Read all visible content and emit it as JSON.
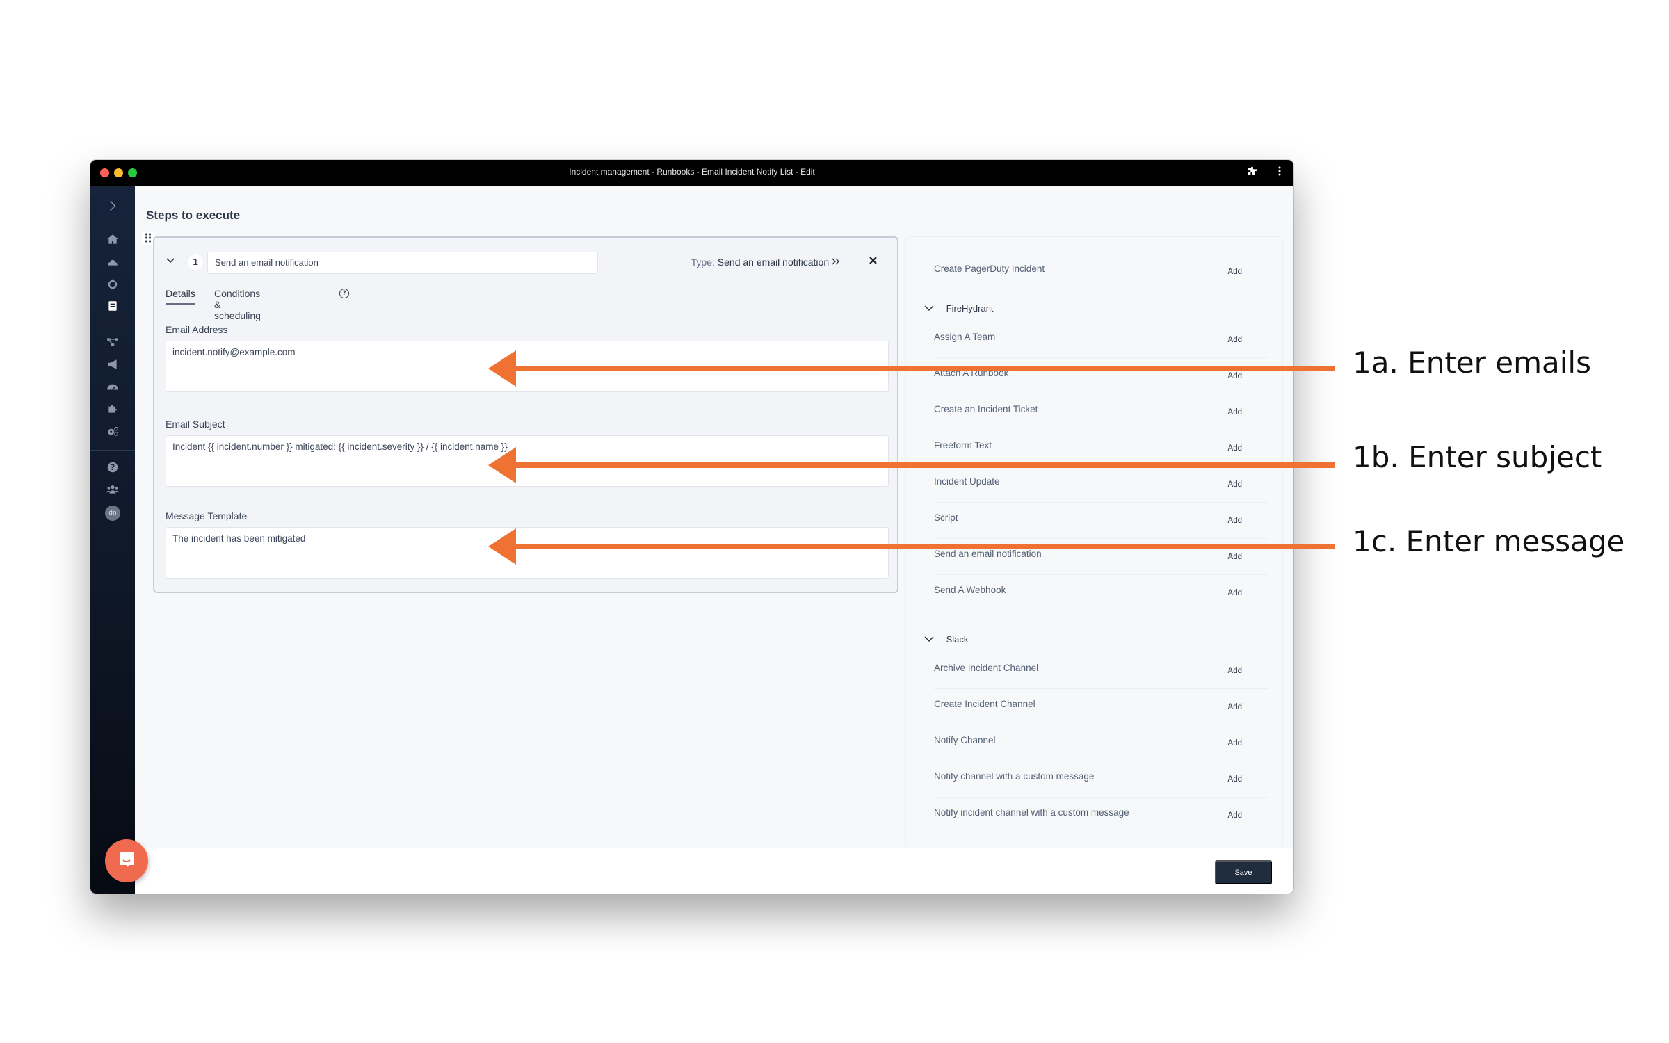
{
  "window": {
    "title": "Incident management - Runbooks - Email Incident Notify List - Edit",
    "controls": [
      "extensions-icon",
      "more-icon"
    ]
  },
  "sidebar": {
    "expand_icon": "chevron-right-icon",
    "items": [
      {
        "icon": "home-icon",
        "active": false
      },
      {
        "icon": "cloud-fire-icon",
        "active": false
      },
      {
        "icon": "fire-icon",
        "active": false
      },
      {
        "icon": "runbook-icon",
        "active": true
      },
      {
        "icon": "services-tree-icon",
        "active": false
      },
      {
        "icon": "megaphone-icon",
        "active": false
      },
      {
        "icon": "dashboard-gauge-icon",
        "active": false
      },
      {
        "icon": "integrations-puzzle-icon",
        "active": false
      },
      {
        "icon": "settings-gears-icon",
        "active": false
      },
      {
        "icon": "help-icon",
        "active": false
      },
      {
        "icon": "team-icon",
        "active": false
      }
    ],
    "avatar_initials": "dn"
  },
  "main": {
    "title": "Steps to execute",
    "step": {
      "number": "1",
      "name": "Send an email notification",
      "type_label": "Type:",
      "type_value": "Send an email notification",
      "tabs": [
        {
          "label": "Details",
          "active": true
        },
        {
          "label": "Conditions & scheduling",
          "active": false
        }
      ],
      "fields": [
        {
          "label": "Email Address",
          "value": "incident.notify@example.com"
        },
        {
          "label": "Email Subject",
          "value": "Incident {{ incident.number }} mitigated: {{ incident.severity }} / {{ incident.name }}"
        },
        {
          "label": "Message Template",
          "value": "The incident has been mitigated"
        }
      ]
    }
  },
  "right_panel": {
    "add_label": "Add",
    "top_items": [
      "Create PagerDuty Incident"
    ],
    "groups": [
      {
        "name": "FireHydrant",
        "items": [
          "Assign A Team",
          "Attach A Runbook",
          "Create an Incident Ticket",
          "Freeform Text",
          "Incident Update",
          "Script",
          "Send an email notification",
          "Send A Webhook"
        ]
      },
      {
        "name": "Slack",
        "items": [
          "Archive Incident Channel",
          "Create Incident Channel",
          "Notify Channel",
          "Notify channel with a custom message",
          "Notify incident channel with a custom message"
        ]
      }
    ]
  },
  "footer": {
    "save_label": "Save"
  },
  "annotations": [
    {
      "label": "1a. Enter emails",
      "target": "Email Address"
    },
    {
      "label": "1b. Enter subject",
      "target": "Email Subject"
    },
    {
      "label": "1c. Enter message",
      "target": "Message Template"
    }
  ],
  "colors": {
    "arrow": "#f07232",
    "save_button": "#1f2d3f",
    "chat_bubble": "#f06a50",
    "sidebar": "#0f1828"
  }
}
